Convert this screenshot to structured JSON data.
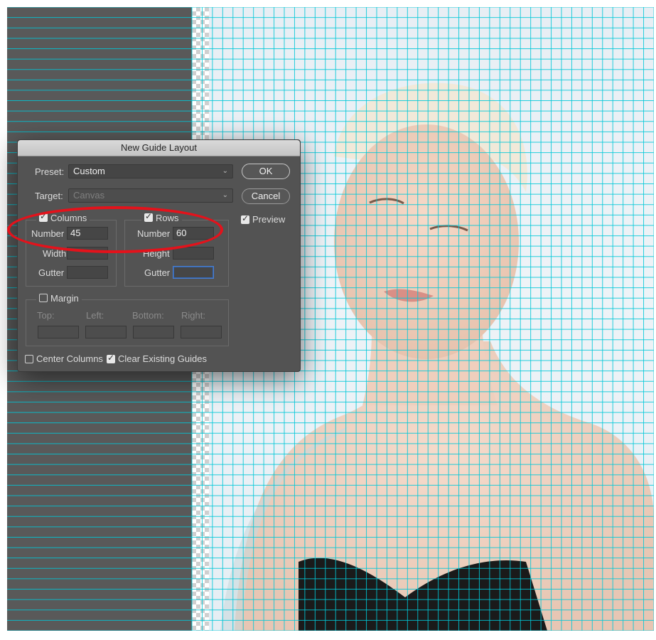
{
  "dialog": {
    "title": "New Guide Layout",
    "preset": {
      "label": "Preset:",
      "value": "Custom"
    },
    "target": {
      "label": "Target:",
      "value": "Canvas"
    },
    "ok_label": "OK",
    "cancel_label": "Cancel",
    "preview": {
      "label": "Preview",
      "checked": true
    },
    "columns": {
      "label": "Columns",
      "checked": true,
      "number_label": "Number",
      "number_value": "45",
      "width_label": "Width",
      "width_value": "",
      "gutter_label": "Gutter",
      "gutter_value": ""
    },
    "rows": {
      "label": "Rows",
      "checked": true,
      "number_label": "Number",
      "number_value": "60",
      "height_label": "Height",
      "height_value": "",
      "gutter_label": "Gutter",
      "gutter_value": ""
    },
    "margin": {
      "label": "Margin",
      "checked": false,
      "top_label": "Top:",
      "left_label": "Left:",
      "bottom_label": "Bottom:",
      "right_label": "Right:"
    },
    "center_columns": {
      "label": "Center Columns",
      "checked": false
    },
    "clear_guides": {
      "label": "Clear Existing Guides",
      "checked": true
    }
  },
  "colors": {
    "guide": "#00c8d8",
    "workspace": "#595959",
    "highlight": "#e4121b"
  },
  "guides": {
    "columns": 45,
    "rows": 60
  }
}
